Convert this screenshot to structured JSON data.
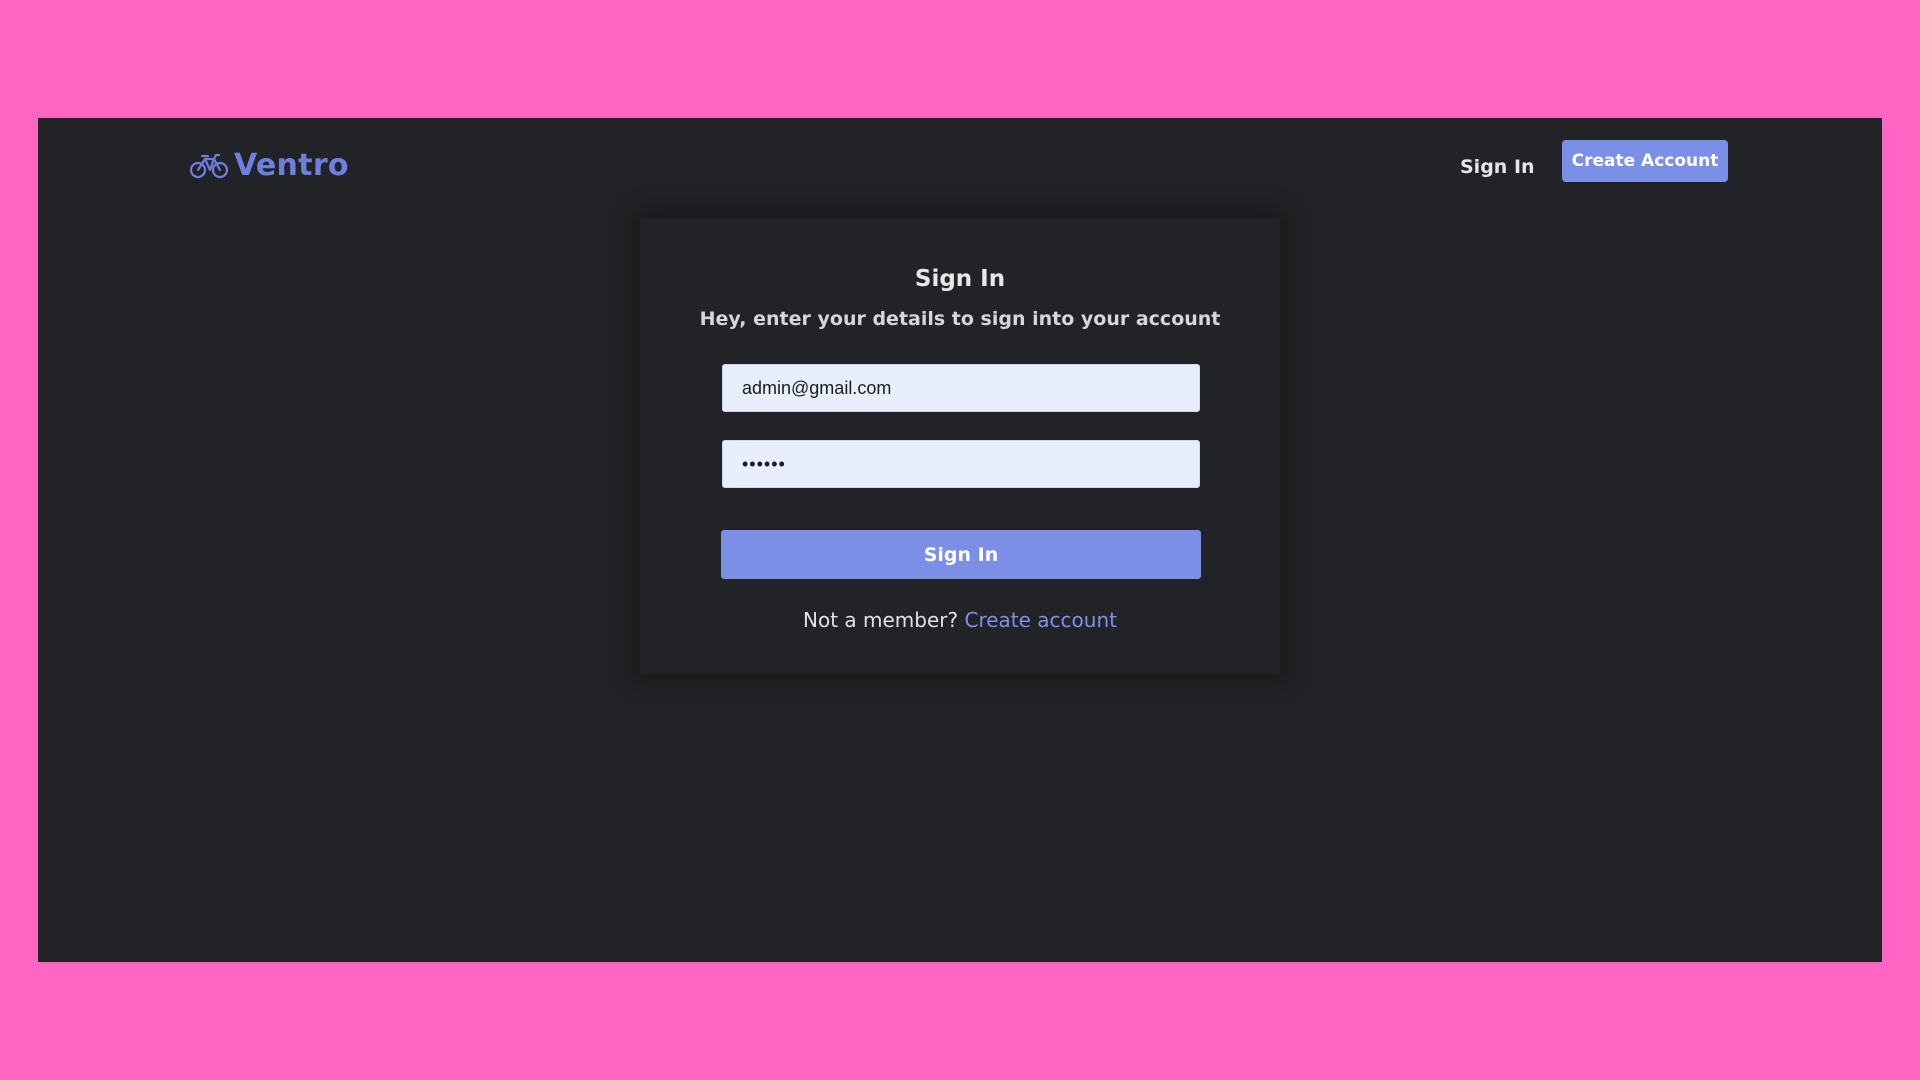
{
  "header": {
    "logo_icon": "bicycle-icon",
    "logo_text": "Ventro",
    "signin_link": "Sign In",
    "create_account_button": "Create Account"
  },
  "card": {
    "title": "Sign In",
    "subtitle": "Hey, enter your details to sign into your account",
    "email_value": "admin@gmail.com",
    "password_value": "••••••",
    "signin_button": "Sign In",
    "footer_prompt": "Not a member?",
    "footer_link": "Create account"
  },
  "colors": {
    "page_background": "#ff66c4",
    "app_background": "#222326",
    "accent": "#7b8fe6",
    "logo": "#6f7fe0",
    "input_background": "#e9eefc"
  }
}
